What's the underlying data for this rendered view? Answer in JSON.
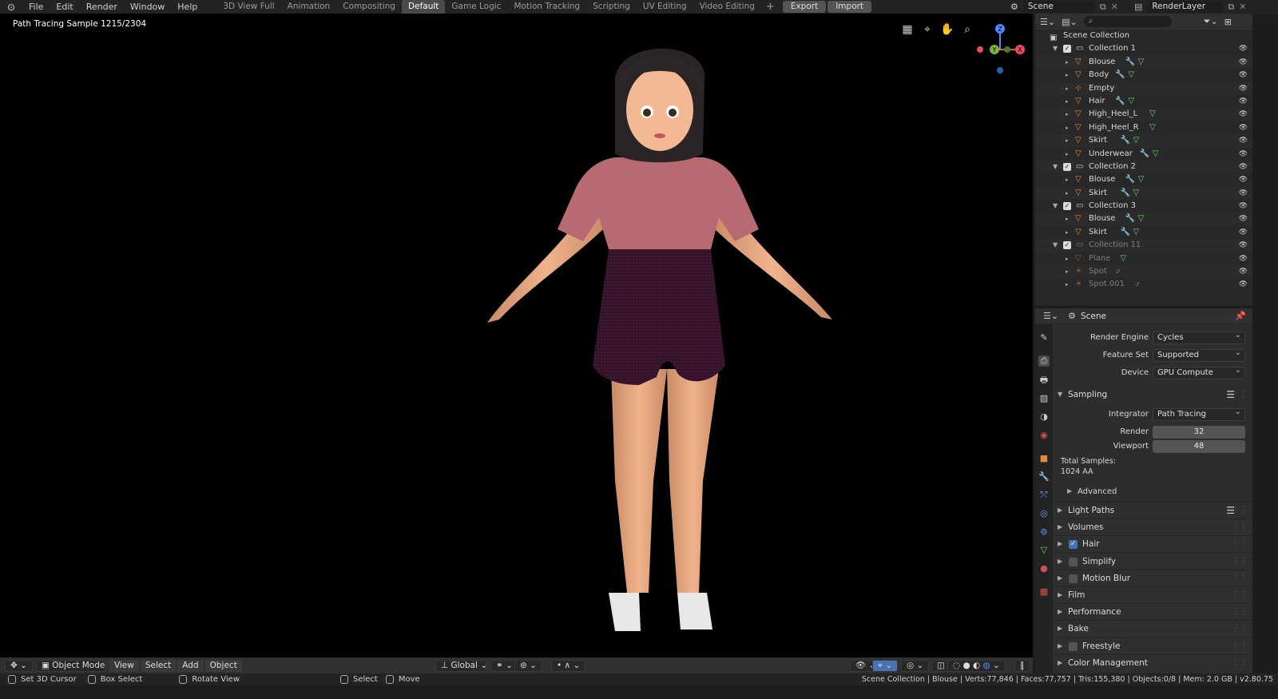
{
  "topbar": {
    "menus": [
      "File",
      "Edit",
      "Render",
      "Window",
      "Help"
    ],
    "workspaces": [
      "3D View Full",
      "Animation",
      "Compositing",
      "Default",
      "Game Logic",
      "Motion Tracking",
      "Scripting",
      "UV Editing",
      "Video Editing"
    ],
    "active_workspace": "Default",
    "add_label": "+",
    "export_label": "Export",
    "import_label": "Import",
    "scene_name": "Scene",
    "render_layer": "RenderLayer"
  },
  "viewport": {
    "overlay_text": "Path Tracing Sample 1215/2304",
    "gizmo": {
      "z": "Z",
      "y": "Y",
      "x": "X"
    },
    "header": {
      "mode": "Object Mode",
      "menus": [
        "View",
        "Select",
        "Add",
        "Object"
      ],
      "orientation": "Global"
    }
  },
  "statusbar": {
    "hint1": "Set 3D Cursor",
    "hint2": "Box Select",
    "hint3": "Rotate View",
    "hint4": "Select",
    "hint5": "Move",
    "info": "Scene Collection | Blouse | Verts:77,846 | Faces:77,757 | Tris:155,380 | Objects:0/8 | Mem: 2.0 GB | v2.80.75"
  },
  "outliner": {
    "root": "Scene Collection",
    "rows": [
      {
        "label": "Collection 1",
        "kind": "collection",
        "depth": 1
      },
      {
        "label": "Blouse",
        "kind": "mesh",
        "depth": 2,
        "mod": true
      },
      {
        "label": "Body",
        "kind": "mesh",
        "depth": 2,
        "mod": true
      },
      {
        "label": "Empty",
        "kind": "empty",
        "depth": 2,
        "mod": false
      },
      {
        "label": "Hair",
        "kind": "mesh",
        "depth": 2,
        "mod": true
      },
      {
        "label": "High_Heel_L",
        "kind": "mesh",
        "depth": 2,
        "mod": false
      },
      {
        "label": "High_Heel_R",
        "kind": "mesh",
        "depth": 2,
        "mod": false
      },
      {
        "label": "Skirt",
        "kind": "mesh",
        "depth": 2,
        "mod": true
      },
      {
        "label": "Underwear",
        "kind": "mesh",
        "depth": 2,
        "mod": true
      },
      {
        "label": "Collection 2",
        "kind": "collection",
        "depth": 1
      },
      {
        "label": "Blouse",
        "kind": "mesh",
        "depth": 2,
        "mod": true
      },
      {
        "label": "Skirt",
        "kind": "mesh",
        "depth": 2,
        "mod": true
      },
      {
        "label": "Collection 3",
        "kind": "collection",
        "depth": 1
      },
      {
        "label": "Blouse",
        "kind": "mesh",
        "depth": 2,
        "mod": true
      },
      {
        "label": "Skirt",
        "kind": "mesh",
        "depth": 2,
        "mod": true
      },
      {
        "label": "Collection 11",
        "kind": "collection",
        "depth": 1,
        "dim": true
      },
      {
        "label": "Plane",
        "kind": "mesh",
        "depth": 2,
        "dim": true
      },
      {
        "label": "Spot",
        "kind": "light",
        "depth": 2,
        "dim": true
      },
      {
        "label": "Spot.001",
        "kind": "light",
        "depth": 2,
        "dim": true
      }
    ]
  },
  "properties": {
    "context": "Scene",
    "render_engine_label": "Render Engine",
    "render_engine": "Cycles",
    "feature_set_label": "Feature Set",
    "feature_set": "Supported",
    "device_label": "Device",
    "device": "GPU Compute",
    "sampling_title": "Sampling",
    "integrator_label": "Integrator",
    "integrator": "Path Tracing",
    "render_label": "Render",
    "render_samples": "32",
    "viewport_label": "Viewport",
    "viewport_samples": "48",
    "total_samples_label": "Total Samples:",
    "total_samples": "1024 AA",
    "advanced": "Advanced",
    "panels": [
      {
        "title": "Light Paths",
        "check": null,
        "list": true
      },
      {
        "title": "Volumes",
        "check": null
      },
      {
        "title": "Hair",
        "check": true
      },
      {
        "title": "Simplify",
        "check": false
      },
      {
        "title": "Motion Blur",
        "check": false
      },
      {
        "title": "Film",
        "check": null
      },
      {
        "title": "Performance",
        "check": null
      },
      {
        "title": "Bake",
        "check": null
      },
      {
        "title": "Freestyle",
        "check": false
      },
      {
        "title": "Color Management",
        "check": null
      }
    ]
  },
  "colors": {
    "accent": "#4772b3",
    "object_orange": "#e8883a",
    "modifier_blue": "#6a9bff",
    "mesh_green": "#6fd36f"
  }
}
